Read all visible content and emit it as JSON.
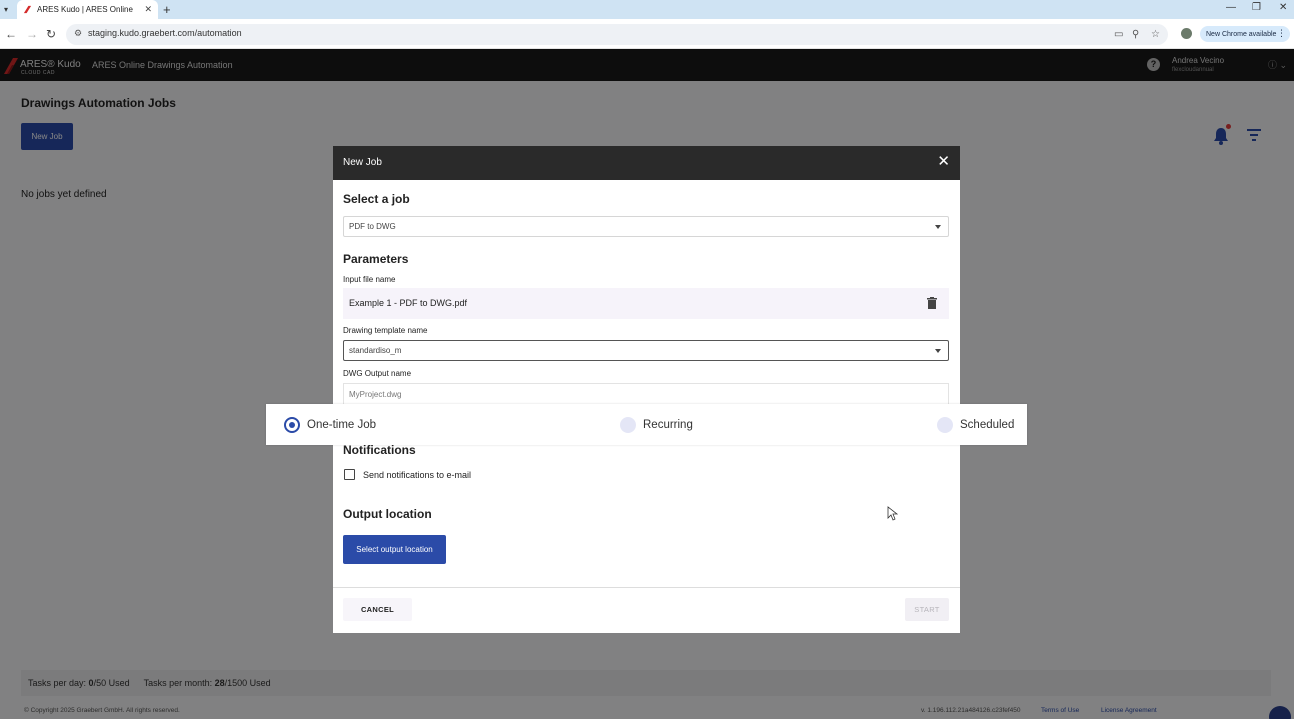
{
  "browser": {
    "tab_title": "ARES Kudo | ARES Online Draw",
    "url": "staging.kudo.graebert.com/automation",
    "new_chrome_label": "New Chrome available"
  },
  "app": {
    "brand_name": "ARES® Kudo",
    "brand_sub": "CLOUD CAD",
    "app_title": "ARES Online Drawings Automation",
    "user_name": "Andrea Vecino",
    "user_plan": "flexcloudannual"
  },
  "page": {
    "title": "Drawings Automation Jobs",
    "new_job_label": "New Job",
    "empty_message": "No jobs yet defined"
  },
  "usage": {
    "day_label": "Tasks per day:",
    "day_used": "0",
    "day_rest": "/50 Used",
    "month_label": "Tasks per month:",
    "month_used": "28",
    "month_rest": "/1500 Used"
  },
  "footer": {
    "copyright": "© Copyright 2025 Graebert GmbH. All rights reserved.",
    "version": "v. 1.196.112.21a484126.c23fef450",
    "terms": "Terms of Use",
    "license": "License Agreement"
  },
  "modal": {
    "title": "New Job",
    "select_job_heading": "Select a job",
    "job_value": "PDF to DWG",
    "parameters_heading": "Parameters",
    "input_file_label": "Input file name",
    "input_file_value": "Example 1 - PDF to DWG.pdf",
    "template_label": "Drawing template name",
    "template_value": "standardiso_m",
    "output_name_label": "DWG Output name",
    "output_name_value": "MyProject.dwg",
    "schedule_options": [
      {
        "label": "One-time Job",
        "selected": true
      },
      {
        "label": "Recurring",
        "selected": false
      },
      {
        "label": "Scheduled",
        "selected": false
      }
    ],
    "notifications_heading": "Notifications",
    "notify_label": "Send notifications to e-mail",
    "notify_checked": false,
    "output_location_heading": "Output location",
    "select_output_label": "Select output location",
    "cancel_label": "CANCEL",
    "start_label": "START"
  },
  "colors": {
    "primary": "#2b4ba8",
    "header_bg": "#1a1a1a",
    "modal_header_bg": "#2a2a2a",
    "notification_dot": "#e13c3c"
  }
}
